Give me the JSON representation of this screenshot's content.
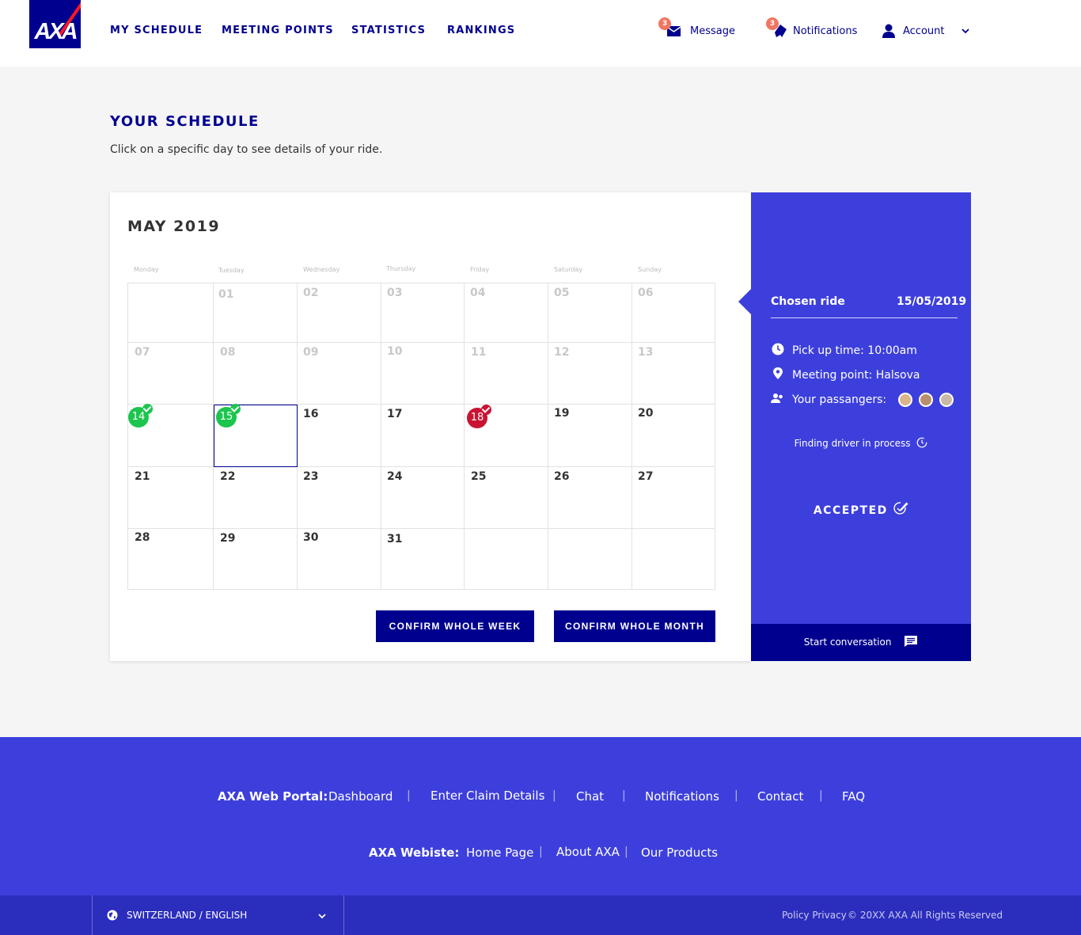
{
  "header": {
    "logo_text": "AXA",
    "nav": [
      "MY SCHEDULE",
      "MEETING POINTS",
      "STATISTICS",
      "RANKINGS"
    ],
    "message": {
      "label": "Message",
      "badge": "3"
    },
    "notifications": {
      "label": "Notifications",
      "badge": "3"
    },
    "account": {
      "label": "Account"
    }
  },
  "schedule": {
    "title": "YOUR SCHEDULE",
    "subtitle": "Click on a specific day to see details of your ride."
  },
  "calendar": {
    "month": "MAY 2019",
    "weekdays": [
      "Monday",
      "Tuesday",
      "Wednesday",
      "Thursday",
      "Friday",
      "Saturday",
      "Sunday"
    ],
    "weeks": [
      [
        "",
        "01",
        "02",
        "03",
        "04",
        "05",
        "06"
      ],
      [
        "07",
        "08",
        "09",
        "10",
        "11",
        "12",
        "13"
      ],
      [
        "14",
        "15",
        "16",
        "17",
        "18",
        "19",
        "20"
      ],
      [
        "21",
        "22",
        "23",
        "24",
        "25",
        "26",
        "27"
      ],
      [
        "28",
        "29",
        "30",
        "31",
        "",
        "",
        ""
      ]
    ],
    "confirmed_days": [
      "14",
      "15"
    ],
    "declined_days": [
      "18"
    ],
    "selected_day": "15",
    "confirm_week": "CONFIRM WHOLE WEEK",
    "confirm_month": "CONFIRM WHOLE MONTH"
  },
  "ride": {
    "label": "Chosen ride",
    "date": "15/05/2019",
    "pickup": "Pick up time: 10:00am",
    "meeting": "Meeting point: Halsova",
    "passengers": "Your passangers:",
    "finding": "Finding driver in process",
    "status": "ACCEPTED",
    "start_conversation": "Start conversation"
  },
  "footer": {
    "portal_label": "AXA Web Portal:",
    "portal_links": [
      "Dashboard",
      "Enter Claim Details",
      "Chat",
      "Notifications",
      "Contact",
      "FAQ"
    ],
    "website_label": "AXA Webiste:",
    "website_links": [
      "Home Page",
      "About AXA",
      "Our Products"
    ],
    "language": "SWITZERLAND / ENGLISH",
    "policy": "Policy Privacy",
    "copyright": "© 20XX AXA All Rights Reserved"
  },
  "colors": {
    "brand_navy": "#00008f",
    "brand_blue": "#3d3fdc",
    "accepted_green": "#1cc54e",
    "declined_red": "#c91432",
    "badge": "#f07662"
  }
}
